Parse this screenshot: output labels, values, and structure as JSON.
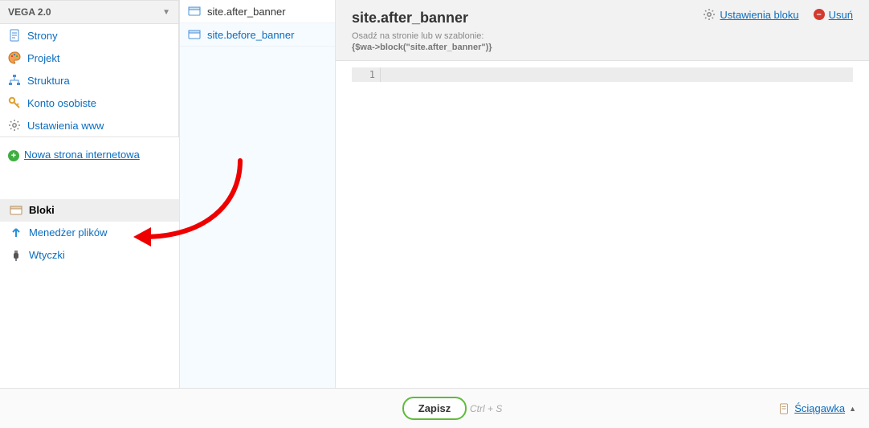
{
  "sidebar": {
    "site_name": "VEGA 2.0",
    "nav": [
      {
        "icon": "page-icon",
        "label": "Strony"
      },
      {
        "icon": "palette-icon",
        "label": "Projekt"
      },
      {
        "icon": "tree-icon",
        "label": "Struktura"
      },
      {
        "icon": "key-icon",
        "label": "Konto osobiste"
      },
      {
        "icon": "gear-icon",
        "label": "Ustawienia www"
      }
    ],
    "new_page_label": "Nowa strona internetowa",
    "nav2": [
      {
        "icon": "block-icon",
        "label": "Bloki",
        "selected": true
      },
      {
        "icon": "upload-icon",
        "label": "Menedżer plików",
        "selected": false
      },
      {
        "icon": "plug-icon",
        "label": "Wtyczki",
        "selected": false
      }
    ]
  },
  "middle": {
    "blocks": [
      {
        "label": "site.after_banner",
        "active": true
      },
      {
        "label": "site.before_banner",
        "active": false
      }
    ]
  },
  "main": {
    "title": "site.after_banner",
    "embed_hint_label": "Osadź na stronie lub w szablonie:",
    "embed_code": "{$wa->block(\"site.after_banner\")}",
    "actions": {
      "settings_label": "Ustawienia bloku",
      "delete_label": "Usuń"
    },
    "editor": {
      "line_number": "1"
    }
  },
  "footer": {
    "save_label": "Zapisz",
    "shortcut_label": "Ctrl + S",
    "cheatsheet_label": "Ściągawka"
  },
  "colors": {
    "link": "#0b6cbf",
    "accent_green": "#5fbb3a",
    "danger": "#d23a2e"
  }
}
